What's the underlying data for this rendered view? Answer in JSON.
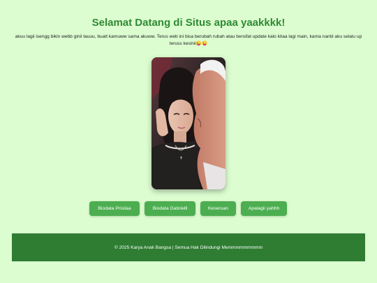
{
  "header": {
    "title": "Selamat Datang di Situs apaa yaakkkk!"
  },
  "intro": {
    "text": "akuu lagii isengg bikin webb ginii tauuu, buatt kamuww sama akuww. Terus web ini bisa berubah rubah atau bersifat update kalo kitaa lagi main, karna nantii aku selalu up teruss kesinii😜😜"
  },
  "photo": {
    "icon": "portrait-photo"
  },
  "nav": {
    "buttons": [
      {
        "label": "Biodata Prisilaa"
      },
      {
        "label": "Biodata Gabrielll"
      },
      {
        "label": "Keseruan"
      },
      {
        "label": "Apalagii yahhh"
      }
    ]
  },
  "footer": {
    "text": "© 2025 Karya Anak Bangsa | Semua Hak Dilindungi Memmmmmmmmm"
  },
  "colors": {
    "background": "#dcfdd0",
    "title": "#2f8a34",
    "button": "#4cae50",
    "footer": "#2e7d32"
  }
}
